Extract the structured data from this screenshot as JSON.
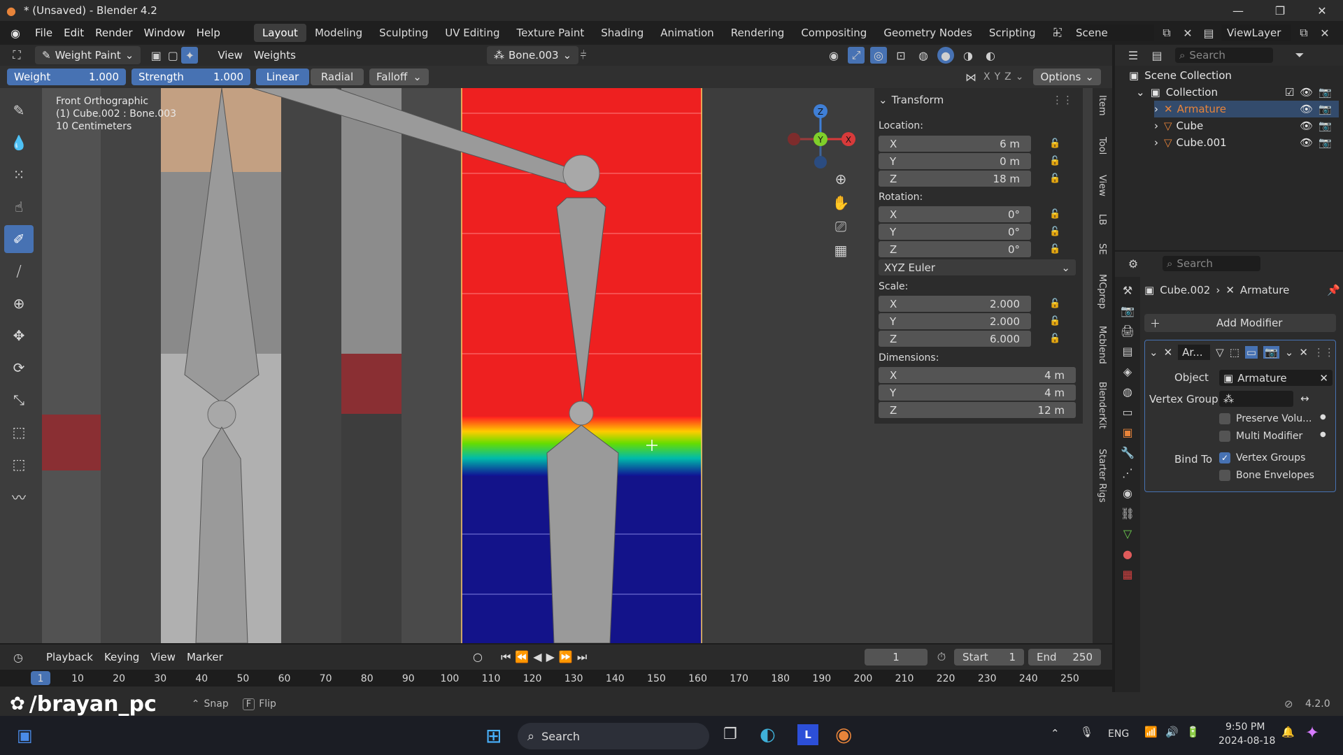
{
  "window": {
    "title": "* (Unsaved) - Blender 4.2",
    "minimize": "—",
    "maximize": "❐",
    "close": "✕"
  },
  "menu": {
    "items": [
      "File",
      "Edit",
      "Render",
      "Window",
      "Help"
    ]
  },
  "workspaces": {
    "tabs": [
      "Layout",
      "Modeling",
      "Sculpting",
      "UV Editing",
      "Texture Paint",
      "Shading",
      "Animation",
      "Rendering",
      "Compositing",
      "Geometry Nodes",
      "Scripting"
    ],
    "active": "Layout",
    "add": "+"
  },
  "scene": {
    "label": "Scene",
    "view_layer": "ViewLayer"
  },
  "header": {
    "mode": "Weight Paint",
    "view": "View",
    "weights": "Weights",
    "bone": "Bone.003",
    "options": "Options",
    "axes": [
      "X",
      "Y",
      "Z"
    ]
  },
  "toolsettings": {
    "weight_label": "Weight",
    "weight_value": "1.000",
    "strength_label": "Strength",
    "strength_value": "1.000",
    "linear": "Linear",
    "radial": "Radial",
    "falloff": "Falloff"
  },
  "viewport": {
    "overlay_lines": [
      "Front Orthographic",
      "(1) Cube.002 : Bone.003",
      "10 Centimeters"
    ]
  },
  "gizmo": {
    "z": "Z",
    "y": "Y",
    "x": "X"
  },
  "transform": {
    "title": "Transform",
    "location_label": "Location:",
    "location": [
      {
        "axis": "X",
        "value": "6 m"
      },
      {
        "axis": "Y",
        "value": "0 m"
      },
      {
        "axis": "Z",
        "value": "18 m"
      }
    ],
    "rotation_label": "Rotation:",
    "rotation": [
      {
        "axis": "X",
        "value": "0°"
      },
      {
        "axis": "Y",
        "value": "0°"
      },
      {
        "axis": "Z",
        "value": "0°"
      }
    ],
    "rotation_mode": "XYZ Euler",
    "scale_label": "Scale:",
    "scale": [
      {
        "axis": "X",
        "value": "2.000"
      },
      {
        "axis": "Y",
        "value": "2.000"
      },
      {
        "axis": "Z",
        "value": "6.000"
      }
    ],
    "dimensions_label": "Dimensions:",
    "dimensions": [
      {
        "axis": "X",
        "value": "4 m"
      },
      {
        "axis": "Y",
        "value": "4 m"
      },
      {
        "axis": "Z",
        "value": "12 m"
      }
    ]
  },
  "sidebar_tabs": [
    "Item",
    "Tool",
    "View",
    "LB",
    "SE",
    "MCprep",
    "Mcblend",
    "BlenderKit",
    "Starter Rigs"
  ],
  "outliner": {
    "search": "Search",
    "scene_collection": "Scene Collection",
    "collection": "Collection",
    "items": [
      "Armature",
      "Cube",
      "Cube.001"
    ]
  },
  "properties": {
    "search": "Search",
    "breadcrumb_object": "Cube.002",
    "breadcrumb_modifier": "Armature",
    "add_modifier": "Add Modifier",
    "modifier_name": "Ar...",
    "object_label": "Object",
    "object_value": "Armature",
    "vertex_group_label": "Vertex Group",
    "preserve_volume": "Preserve Volu...",
    "multi_modifier": "Multi Modifier",
    "bind_to_label": "Bind To",
    "vertex_groups": "Vertex Groups",
    "bone_envelopes": "Bone Envelopes"
  },
  "timeline": {
    "playback": "Playback",
    "keying": "Keying",
    "view": "View",
    "marker": "Marker",
    "current_frame": "1",
    "start_label": "Start",
    "start": "1",
    "end_label": "End",
    "end": "250",
    "ruler": [
      "1",
      "10",
      "20",
      "30",
      "40",
      "50",
      "60",
      "70",
      "80",
      "90",
      "100",
      "110",
      "120",
      "130",
      "140",
      "150",
      "160",
      "170",
      "180",
      "190",
      "200",
      "210",
      "220",
      "230",
      "240",
      "250"
    ]
  },
  "statusbar": {
    "watermark": "/brayan_pc",
    "hints": [
      "Snap",
      "F",
      "Flip"
    ],
    "version": "4.2.0"
  },
  "taskbar": {
    "search": "Search",
    "lang": "ENG",
    "time": "9:50 PM",
    "date": "2024-08-18"
  },
  "colors": {
    "accent": "#4772b3",
    "weight_red": "#ff2020",
    "weight_blue": "#101090",
    "armature_orange": "#e8843a"
  }
}
